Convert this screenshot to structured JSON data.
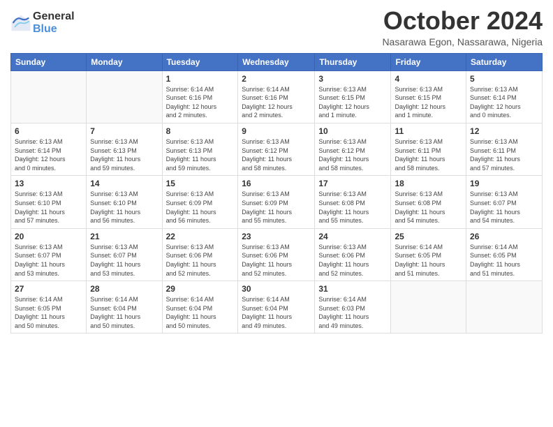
{
  "header": {
    "logo_general": "General",
    "logo_blue": "Blue",
    "month": "October 2024",
    "location": "Nasarawa Egon, Nassarawa, Nigeria"
  },
  "days_of_week": [
    "Sunday",
    "Monday",
    "Tuesday",
    "Wednesday",
    "Thursday",
    "Friday",
    "Saturday"
  ],
  "weeks": [
    [
      {
        "day": "",
        "info": ""
      },
      {
        "day": "",
        "info": ""
      },
      {
        "day": "1",
        "info": "Sunrise: 6:14 AM\nSunset: 6:16 PM\nDaylight: 12 hours\nand 2 minutes."
      },
      {
        "day": "2",
        "info": "Sunrise: 6:14 AM\nSunset: 6:16 PM\nDaylight: 12 hours\nand 2 minutes."
      },
      {
        "day": "3",
        "info": "Sunrise: 6:13 AM\nSunset: 6:15 PM\nDaylight: 12 hours\nand 1 minute."
      },
      {
        "day": "4",
        "info": "Sunrise: 6:13 AM\nSunset: 6:15 PM\nDaylight: 12 hours\nand 1 minute."
      },
      {
        "day": "5",
        "info": "Sunrise: 6:13 AM\nSunset: 6:14 PM\nDaylight: 12 hours\nand 0 minutes."
      }
    ],
    [
      {
        "day": "6",
        "info": "Sunrise: 6:13 AM\nSunset: 6:14 PM\nDaylight: 12 hours\nand 0 minutes."
      },
      {
        "day": "7",
        "info": "Sunrise: 6:13 AM\nSunset: 6:13 PM\nDaylight: 11 hours\nand 59 minutes."
      },
      {
        "day": "8",
        "info": "Sunrise: 6:13 AM\nSunset: 6:13 PM\nDaylight: 11 hours\nand 59 minutes."
      },
      {
        "day": "9",
        "info": "Sunrise: 6:13 AM\nSunset: 6:12 PM\nDaylight: 11 hours\nand 58 minutes."
      },
      {
        "day": "10",
        "info": "Sunrise: 6:13 AM\nSunset: 6:12 PM\nDaylight: 11 hours\nand 58 minutes."
      },
      {
        "day": "11",
        "info": "Sunrise: 6:13 AM\nSunset: 6:11 PM\nDaylight: 11 hours\nand 58 minutes."
      },
      {
        "day": "12",
        "info": "Sunrise: 6:13 AM\nSunset: 6:11 PM\nDaylight: 11 hours\nand 57 minutes."
      }
    ],
    [
      {
        "day": "13",
        "info": "Sunrise: 6:13 AM\nSunset: 6:10 PM\nDaylight: 11 hours\nand 57 minutes."
      },
      {
        "day": "14",
        "info": "Sunrise: 6:13 AM\nSunset: 6:10 PM\nDaylight: 11 hours\nand 56 minutes."
      },
      {
        "day": "15",
        "info": "Sunrise: 6:13 AM\nSunset: 6:09 PM\nDaylight: 11 hours\nand 56 minutes."
      },
      {
        "day": "16",
        "info": "Sunrise: 6:13 AM\nSunset: 6:09 PM\nDaylight: 11 hours\nand 55 minutes."
      },
      {
        "day": "17",
        "info": "Sunrise: 6:13 AM\nSunset: 6:08 PM\nDaylight: 11 hours\nand 55 minutes."
      },
      {
        "day": "18",
        "info": "Sunrise: 6:13 AM\nSunset: 6:08 PM\nDaylight: 11 hours\nand 54 minutes."
      },
      {
        "day": "19",
        "info": "Sunrise: 6:13 AM\nSunset: 6:07 PM\nDaylight: 11 hours\nand 54 minutes."
      }
    ],
    [
      {
        "day": "20",
        "info": "Sunrise: 6:13 AM\nSunset: 6:07 PM\nDaylight: 11 hours\nand 53 minutes."
      },
      {
        "day": "21",
        "info": "Sunrise: 6:13 AM\nSunset: 6:07 PM\nDaylight: 11 hours\nand 53 minutes."
      },
      {
        "day": "22",
        "info": "Sunrise: 6:13 AM\nSunset: 6:06 PM\nDaylight: 11 hours\nand 52 minutes."
      },
      {
        "day": "23",
        "info": "Sunrise: 6:13 AM\nSunset: 6:06 PM\nDaylight: 11 hours\nand 52 minutes."
      },
      {
        "day": "24",
        "info": "Sunrise: 6:13 AM\nSunset: 6:06 PM\nDaylight: 11 hours\nand 52 minutes."
      },
      {
        "day": "25",
        "info": "Sunrise: 6:14 AM\nSunset: 6:05 PM\nDaylight: 11 hours\nand 51 minutes."
      },
      {
        "day": "26",
        "info": "Sunrise: 6:14 AM\nSunset: 6:05 PM\nDaylight: 11 hours\nand 51 minutes."
      }
    ],
    [
      {
        "day": "27",
        "info": "Sunrise: 6:14 AM\nSunset: 6:05 PM\nDaylight: 11 hours\nand 50 minutes."
      },
      {
        "day": "28",
        "info": "Sunrise: 6:14 AM\nSunset: 6:04 PM\nDaylight: 11 hours\nand 50 minutes."
      },
      {
        "day": "29",
        "info": "Sunrise: 6:14 AM\nSunset: 6:04 PM\nDaylight: 11 hours\nand 50 minutes."
      },
      {
        "day": "30",
        "info": "Sunrise: 6:14 AM\nSunset: 6:04 PM\nDaylight: 11 hours\nand 49 minutes."
      },
      {
        "day": "31",
        "info": "Sunrise: 6:14 AM\nSunset: 6:03 PM\nDaylight: 11 hours\nand 49 minutes."
      },
      {
        "day": "",
        "info": ""
      },
      {
        "day": "",
        "info": ""
      }
    ]
  ]
}
